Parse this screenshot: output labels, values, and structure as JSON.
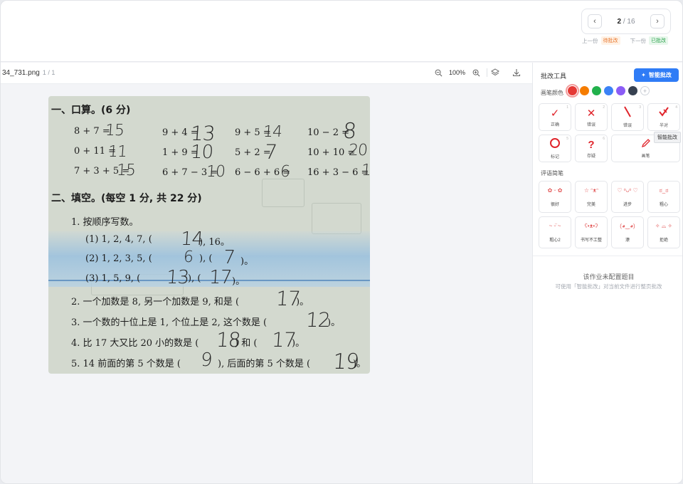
{
  "header": {
    "page_current": "2",
    "page_total": "16",
    "page_sep": " / ",
    "prev_label": "上一份",
    "prev_status": "待批改",
    "next_label": "下一份",
    "next_status": "已批改"
  },
  "file": {
    "name": "34_731.png",
    "pages": "1 / 1",
    "zoom": "100%"
  },
  "worksheet": {
    "section1": "一、口算。(6 分)",
    "calc": [
      {
        "q": "8 + 7 =",
        "a": "15"
      },
      {
        "q": "9 + 4 =",
        "a": "13"
      },
      {
        "q": "9 + 5 =",
        "a": "14"
      },
      {
        "q": "10 − 2 =",
        "a": "8"
      },
      {
        "q": "0 + 11 =",
        "a": "11"
      },
      {
        "q": "1 + 9 =",
        "a": "10"
      },
      {
        "q": "5 + 2 =",
        "a": "7"
      },
      {
        "q": "10 + 10 =",
        "a": "20"
      },
      {
        "q": "7 + 3 + 5 =",
        "a": "15"
      },
      {
        "q": "6 + 7 − 3 =",
        "a": "10"
      },
      {
        "q": "6 − 6 + 6 =",
        "a": "6"
      },
      {
        "q": "16 + 3 − 6 =",
        "a": "1"
      }
    ],
    "section2": "二、填空。(每空 1 分, 共 22 分)",
    "q1": "1. 按顺序写数。",
    "q1_1a": "(1) 1, 2, 4, 7, (",
    "q1_1b": "), 16。",
    "q1_1ans": "14",
    "q1_2a": "(2) 1, 2, 3, 5, (",
    "q1_2b": "), (",
    "q1_2c": ")。",
    "q1_2ans1": "6",
    "q1_2ans2": "7",
    "q1_3a": "(3) 1, 5, 9, (",
    "q1_3b": "), (",
    "q1_3c": ")。",
    "q1_3ans1": "13",
    "q1_3ans2": "17",
    "q2a": "2. 一个加数是 8, 另一个加数是 9, 和是 (",
    "q2b": ")。",
    "q2ans": "17",
    "q3a": "3. 一个数的十位上是 1, 个位上是 2, 这个数是 (",
    "q3b": ")。",
    "q3ans": "12",
    "q4a": "4. 比 17 大又比 20 小的数是 (",
    "q4b": ") 和 (",
    "q4c": ")。",
    "q4ans1": "18",
    "q4ans2": "17",
    "q5a": "5. 14 前面的第 5 个数是 (",
    "q5b": "), 后面的第 5 个数是 (",
    "q5c": ")。",
    "q5ans1": "9",
    "q5ans2": "19"
  },
  "panel": {
    "title": "批改工具",
    "ai_button": "智能批改",
    "color_label": "画笔颜色",
    "colors": [
      "#e53935",
      "#f57c00",
      "#22b14c",
      "#3b82f6",
      "#8b5cf6",
      "#374151"
    ],
    "tools": [
      {
        "label": "正确",
        "num": "1",
        "icon": "check-icon",
        "sym": "✓"
      },
      {
        "label": "错误",
        "num": "2",
        "icon": "cross-icon",
        "sym": "✕"
      },
      {
        "label": "错误",
        "num": "3",
        "icon": "slash-icon",
        "sym": "╲"
      },
      {
        "label": "半对",
        "num": "4",
        "icon": "half-check-icon",
        "sym": "✓̸"
      },
      {
        "label": "标记",
        "num": "5",
        "icon": "circle-icon",
        "sym": "○"
      },
      {
        "label": "存疑",
        "num": "6",
        "icon": "question-icon",
        "sym": "?"
      },
      {
        "label": "画笔",
        "num": "",
        "icon": "pen-icon",
        "sym": "✎"
      }
    ],
    "tooltip": "智能批改",
    "comment_label": "评语简笔",
    "comments": [
      "很好",
      "完美",
      "进步",
      "粗心",
      "粗心2",
      "书写不工整",
      "潦",
      "拒绝"
    ],
    "empty_title": "该作业未配置题目",
    "empty_sub": "可使用「智能批改」对当前文件进行整页批改"
  }
}
